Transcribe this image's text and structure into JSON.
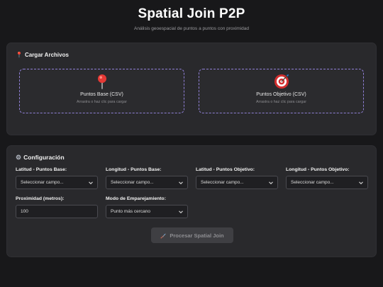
{
  "header": {
    "title": "Spatial Join P2P",
    "subtitle": "Análisis geoespacial de puntos a puntos con proximidad"
  },
  "upload": {
    "title": "Cargar Archivos",
    "title_icon": "pin-icon",
    "dropzones": [
      {
        "icon": "pin-icon",
        "label": "Puntos Base (CSV)",
        "hint": "Arrastra o haz clic para cargar"
      },
      {
        "icon": "target-icon",
        "label": "Puntos Objetivo (CSV)",
        "hint": "Arrastra o haz clic para cargar"
      }
    ]
  },
  "config": {
    "title": "Configuración",
    "title_icon": "gear-icon",
    "fields": [
      {
        "label": "Latitud - Puntos Base:",
        "value": "Seleccionar campo..."
      },
      {
        "label": "Longitud - Puntos Base:",
        "value": "Seleccionar campo..."
      },
      {
        "label": "Latitud - Puntos Objetivo:",
        "value": "Seleccionar campo..."
      },
      {
        "label": "Longitud - Puntos Objetivo:",
        "value": "Seleccionar campo..."
      }
    ],
    "proximity": {
      "label": "Proximidad (metros):",
      "value": "100"
    },
    "mode": {
      "label": "Modo de Emparejamiento:",
      "value": "Punto más cercano"
    },
    "process_button": "Procesar Spatial Join"
  },
  "colors": {
    "background": "#18181a",
    "panel": "#29292c",
    "dropzone_border": "#8f7fd6",
    "pin": "#e53935",
    "target": "#d32f2f"
  }
}
